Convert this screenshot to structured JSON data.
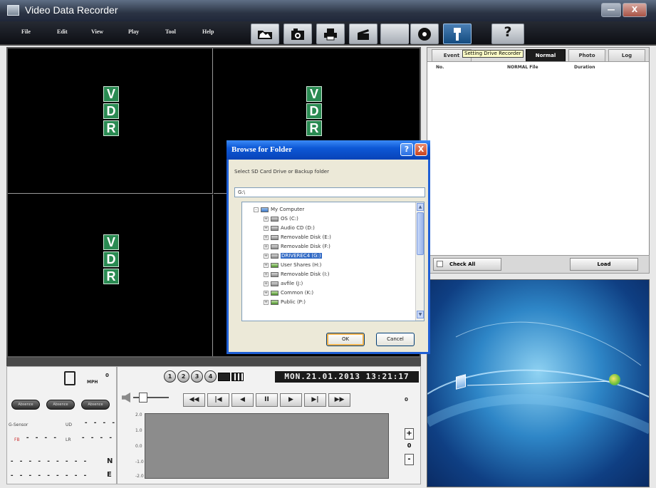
{
  "window": {
    "title": "Video Data Recorder",
    "minimize_label": "—",
    "close_label": "X"
  },
  "menu": [
    "File",
    "Edit",
    "View",
    "Play",
    "Tool",
    "Help"
  ],
  "toolbar": {
    "icons": [
      "folder-icon",
      "camera-icon",
      "printer-icon",
      "clapper-icon",
      "disc-icon",
      "usb-icon",
      "help-icon"
    ],
    "help_label": "?"
  },
  "video": {
    "logo_letters": [
      "V",
      "D",
      "R"
    ]
  },
  "file_panel": {
    "tabs": [
      "Event",
      "Normal",
      "Photo",
      "Log"
    ],
    "tooltip": "Setting Drive Recorder",
    "columns": [
      "No.",
      "NORMAL File",
      "Duration"
    ],
    "check_all_label": "Check All",
    "load_label": "Load"
  },
  "dialog": {
    "title": "Browse for Folder",
    "help_label": "?",
    "close_label": "X",
    "instruction": "Select SD Card Drive or Backup folder",
    "path": "G:\\",
    "tree_root": "My Computer",
    "tree_items": [
      {
        "label": "OS (C:)",
        "selected": false
      },
      {
        "label": "Audio CD (D:)",
        "selected": false
      },
      {
        "label": "Removable Disk (E:)",
        "selected": false
      },
      {
        "label": "Removable Disk (F:)",
        "selected": false
      },
      {
        "label": "DRIVEREC4 (G:)",
        "selected": true
      },
      {
        "label": "User Shares (H:)",
        "selected": false
      },
      {
        "label": "Removable Disk (I:)",
        "selected": false
      },
      {
        "label": "avfile (J:)",
        "selected": false
      },
      {
        "label": "Common (K:)",
        "selected": false
      },
      {
        "label": "Public (P:)",
        "selected": false
      }
    ],
    "ok_label": "OK",
    "cancel_label": "Cancel"
  },
  "speed": {
    "value": "0",
    "unit": "MPH",
    "indicator": "0"
  },
  "status_pills": [
    "Absence",
    "Absence",
    "Absence"
  ],
  "indicators": {
    "row1_left": "G-Sensor",
    "row1_mid": "UD",
    "row1_dash": "- - - -",
    "row2_left": "FB",
    "row2_dash1": "- - - -",
    "row2_mid": "LR",
    "row2_dash2": "- - - -",
    "row3_dash": "- - -   - - -   - - -",
    "row3_dir": "N",
    "row4_dash": "- - -   - - -   - - -",
    "row4_dir": "E"
  },
  "playback": {
    "datetime": "MON.21.01.2013 13:21:17",
    "counter": "0",
    "buttons": [
      "◀◀",
      "|◀",
      "◀",
      "II",
      "▶",
      "▶|",
      "▶▶"
    ]
  },
  "graph": {
    "y_labels": [
      "2.0",
      "1.0",
      "0.0",
      "-1.0",
      "-2.0"
    ]
  },
  "zoom": {
    "plus": "+",
    "value": "0",
    "minus": "-"
  },
  "chart_data": {
    "type": "line",
    "series": [],
    "y_tick_labels": [
      "2.0",
      "1.0",
      "0.0",
      "-1.0",
      "-2.0"
    ],
    "ylim": [
      -2.0,
      2.0
    ],
    "grid": false
  }
}
